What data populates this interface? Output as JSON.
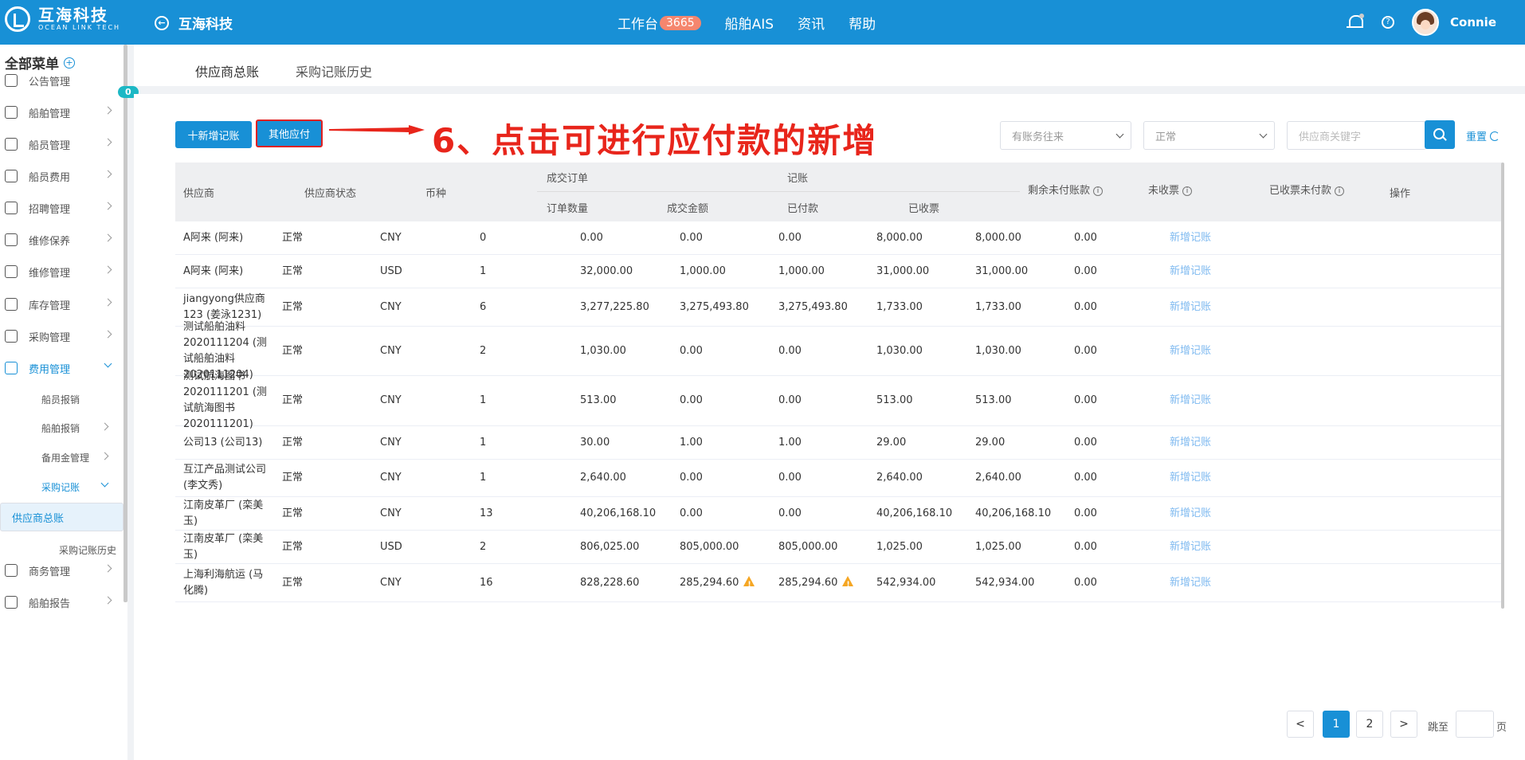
{
  "header": {
    "logo_cn": "互海科技",
    "logo_en": "OCEAN LINK TECH",
    "back_title": "互海科技",
    "nav": [
      {
        "label": "工作台",
        "badge": "3665"
      },
      {
        "label": "船舶AIS"
      },
      {
        "label": "资讯"
      },
      {
        "label": "帮助"
      }
    ],
    "username": "Connie"
  },
  "sidebar": {
    "title": "全部菜单",
    "notice_badge": "0",
    "items": [
      {
        "label": "公告管理"
      },
      {
        "label": "船舶管理"
      },
      {
        "label": "船员管理"
      },
      {
        "label": "船员费用"
      },
      {
        "label": "招聘管理"
      },
      {
        "label": "维修保养"
      },
      {
        "label": "维修管理"
      },
      {
        "label": "库存管理"
      },
      {
        "label": "采购管理"
      },
      {
        "label": "费用管理"
      },
      {
        "label": "商务管理"
      },
      {
        "label": "船舶报告"
      }
    ],
    "sub_items": [
      {
        "label": "船员报销"
      },
      {
        "label": "船舶报销"
      },
      {
        "label": "备用金管理"
      },
      {
        "label": "采购记账"
      }
    ],
    "sub2_items": [
      {
        "label": "供应商总账"
      },
      {
        "label": "采购记账历史"
      }
    ]
  },
  "tabs": [
    {
      "label": "供应商总账"
    },
    {
      "label": "采购记账历史"
    }
  ],
  "toolbar": {
    "add_label": "十新增记账",
    "other_label": "其他应付",
    "annotation": "6、点击可进行应付款的新增",
    "filter1": "有账务往来",
    "filter2": "正常",
    "search_placeholder": "供应商关键字",
    "reset_label": "重置"
  },
  "table": {
    "headers": {
      "supplier": "供应商",
      "status": "供应商状态",
      "currency": "币种",
      "deal_group": "成交订单",
      "order_count": "订单数量",
      "deal_amount": "成交金额",
      "account_group": "记账",
      "paid": "已付款",
      "received": "已收票",
      "remaining": "剩余未付账款",
      "not_received": "未收票",
      "received_unpaid": "已收票未付款",
      "action": "操作"
    },
    "rows": [
      {
        "supplier": "A阿来 (阿来)",
        "status": "正常",
        "currency": "CNY",
        "count": "0",
        "amount": "0.00",
        "paid": "0.00",
        "received": "0.00",
        "remaining": "8,000.00",
        "not_received": "8,000.00",
        "received_unpaid": "0.00",
        "action": "新增记账"
      },
      {
        "supplier": "A阿来 (阿来)",
        "status": "正常",
        "currency": "USD",
        "count": "1",
        "amount": "32,000.00",
        "paid": "1,000.00",
        "received": "1,000.00",
        "remaining": "31,000.00",
        "not_received": "31,000.00",
        "received_unpaid": "0.00",
        "action": "新增记账"
      },
      {
        "supplier": "jiangyong供应商123 (姜泳1231)",
        "status": "正常",
        "currency": "CNY",
        "count": "6",
        "amount": "3,277,225.80",
        "paid": "3,275,493.80",
        "received": "3,275,493.80",
        "remaining": "1,733.00",
        "not_received": "1,733.00",
        "received_unpaid": "0.00",
        "action": "新增记账"
      },
      {
        "supplier": "测试船舶油料2020111204 (测试船舶油料2020111204)",
        "status": "正常",
        "currency": "CNY",
        "count": "2",
        "amount": "1,030.00",
        "paid": "0.00",
        "received": "0.00",
        "remaining": "1,030.00",
        "not_received": "1,030.00",
        "received_unpaid": "0.00",
        "action": "新增记账"
      },
      {
        "supplier": "测试航海图书2020111201 (测试航海图书2020111201)",
        "status": "正常",
        "currency": "CNY",
        "count": "1",
        "amount": "513.00",
        "paid": "0.00",
        "received": "0.00",
        "remaining": "513.00",
        "not_received": "513.00",
        "received_unpaid": "0.00",
        "action": "新增记账"
      },
      {
        "supplier": "公司13 (公司13)",
        "status": "正常",
        "currency": "CNY",
        "count": "1",
        "amount": "30.00",
        "paid": "1.00",
        "received": "1.00",
        "remaining": "29.00",
        "not_received": "29.00",
        "received_unpaid": "0.00",
        "action": "新增记账"
      },
      {
        "supplier": "互江产品测试公司 (李文秀)",
        "status": "正常",
        "currency": "CNY",
        "count": "1",
        "amount": "2,640.00",
        "paid": "0.00",
        "received": "0.00",
        "remaining": "2,640.00",
        "not_received": "2,640.00",
        "received_unpaid": "0.00",
        "action": "新增记账"
      },
      {
        "supplier": "江南皮革厂 (栾美玉)",
        "status": "正常",
        "currency": "CNY",
        "count": "13",
        "amount": "40,206,168.10",
        "paid": "0.00",
        "received": "0.00",
        "remaining": "40,206,168.10",
        "not_received": "40,206,168.10",
        "received_unpaid": "0.00",
        "action": "新增记账"
      },
      {
        "supplier": "江南皮革厂 (栾美玉)",
        "status": "正常",
        "currency": "USD",
        "count": "2",
        "amount": "806,025.00",
        "paid": "805,000.00",
        "received": "805,000.00",
        "remaining": "1,025.00",
        "not_received": "1,025.00",
        "received_unpaid": "0.00",
        "action": "新增记账"
      },
      {
        "supplier": "上海利海航运 (马化腾)",
        "status": "正常",
        "currency": "CNY",
        "count": "16",
        "amount": "828,228.60",
        "paid": "285,294.60",
        "received": "285,294.60",
        "remaining": "542,934.00",
        "not_received": "542,934.00",
        "received_unpaid": "0.00",
        "action": "新增记账",
        "warn": true
      }
    ]
  },
  "pagination": {
    "prev": "<",
    "pages": [
      "1",
      "2"
    ],
    "next": ">",
    "jump_label": "跳至",
    "page_suffix": "页"
  }
}
